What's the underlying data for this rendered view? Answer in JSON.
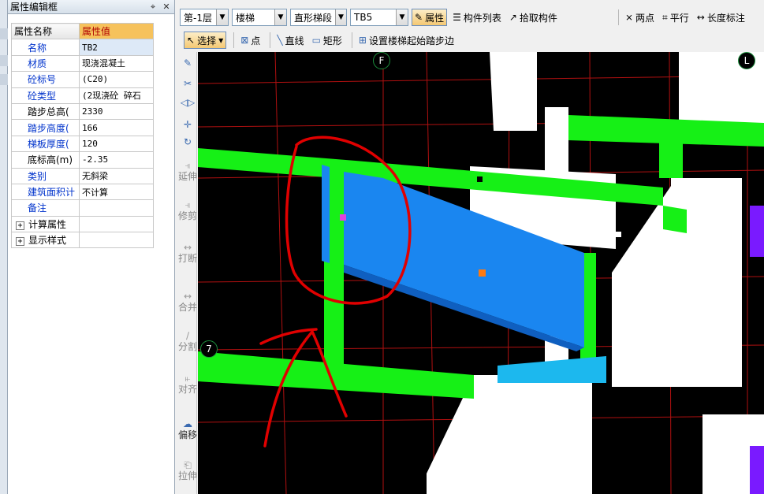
{
  "panel": {
    "title": "属性编辑框",
    "pin_icon": "pin-icon",
    "close_icon": "close-icon",
    "header_name": "属性名称",
    "header_value": "属性值",
    "rows": [
      {
        "name": "名称",
        "value": "TB2"
      },
      {
        "name": "材质",
        "value": "现浇混凝土"
      },
      {
        "name": "砼标号",
        "value": "(C20)"
      },
      {
        "name": "砼类型",
        "value": "(2现浇砼 碎石"
      },
      {
        "name": "踏步总高(",
        "value": "2330"
      },
      {
        "name": "踏步高度(",
        "value": "166"
      },
      {
        "name": "梯板厚度(",
        "value": "120"
      },
      {
        "name": "底标高(m)",
        "value": "-2.35"
      },
      {
        "name": "类别",
        "value": "无斜梁"
      },
      {
        "name": "建筑面积计",
        "value": "不计算"
      },
      {
        "name": "备注",
        "value": ""
      }
    ],
    "groups": [
      {
        "toggle": "+",
        "label": "计算属性"
      },
      {
        "toggle": "+",
        "label": "显示样式"
      }
    ]
  },
  "toolbar1": {
    "floor": "第-1层",
    "category": "楼梯",
    "subtype": "直形梯段",
    "component": "TB5",
    "properties_btn": "属性",
    "component_list_btn": "构件列表",
    "pick_component_btn": "拾取构件",
    "two_points_btn": "两点",
    "parallel_btn": "平行",
    "length_label_btn": "长度标注"
  },
  "toolbar2": {
    "select_btn": "选择",
    "point_btn": "点",
    "line_btn": "直线",
    "rect_btn": "矩形",
    "set_start_step_btn": "设置楼梯起始踏步边"
  },
  "vtoolbar": {
    "extend": "延伸",
    "trim": "修剪",
    "break": "打断",
    "merge": "合并",
    "split": "分割",
    "align": "对齐",
    "offset": "偏移",
    "stretch": "拉伸"
  },
  "viewport": {
    "axis_f": "F",
    "axis_l": "L",
    "axis_7": "7"
  },
  "colors": {
    "beam": "#16f016",
    "stair": "#1a86f0",
    "wall": "#ffffff",
    "grid": "#b01010",
    "annotation": "#e00000",
    "selected_panel_value": "#f6c25c"
  }
}
